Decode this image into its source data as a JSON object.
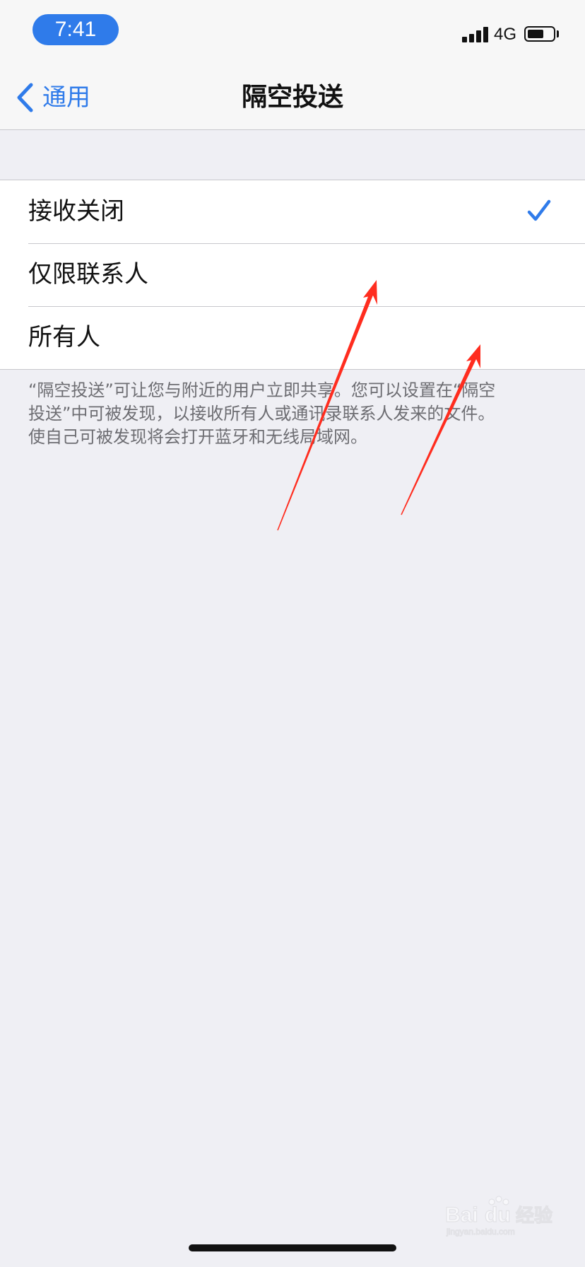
{
  "status_bar": {
    "time": "7:41",
    "network": "4G",
    "signal_icon": "cellular-signal-icon",
    "battery_icon": "battery-icon",
    "battery_level": 0.65
  },
  "nav": {
    "back_label": "通用",
    "back_icon": "chevron-left-icon",
    "title": "隔空投送"
  },
  "options": [
    {
      "label": "接收关闭",
      "selected": true
    },
    {
      "label": "仅限联系人",
      "selected": false
    },
    {
      "label": "所有人",
      "selected": false
    }
  ],
  "footer_lines": [
    "“隔空投送”可让您与附近的用户立即共享。您可以设置在“隔空",
    "投送”中可被发现，以接收所有人或通讯录联系人发来的文件。",
    "使自己可被发现将会打开蓝牙和无线局域网。"
  ],
  "colors": {
    "accent": "#2f7bea",
    "annotation": "#ff2d1f",
    "background": "#efeff4"
  },
  "watermark": {
    "text": "Bai du 经验",
    "subtext": "jingyan.baidu.com"
  }
}
